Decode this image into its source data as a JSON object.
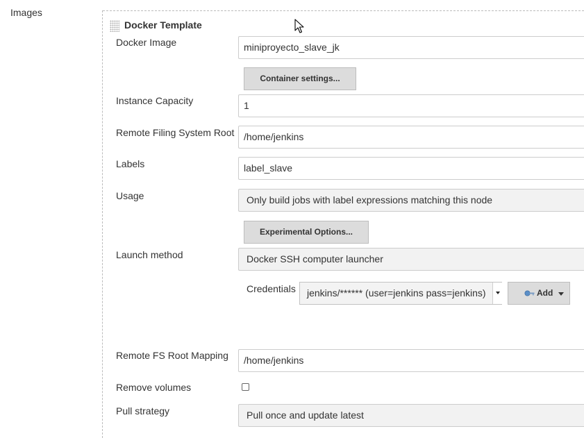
{
  "section": {
    "label": "Images"
  },
  "template": {
    "title": "Docker Template"
  },
  "fields": {
    "docker_image": {
      "label": "Docker Image",
      "value": "miniproyecto_slave_jk"
    },
    "container_settings_button": "Container settings...",
    "instance_capacity": {
      "label": "Instance Capacity",
      "value": "1"
    },
    "remote_fs_root": {
      "label": "Remote Filing System Root",
      "value": "/home/jenkins"
    },
    "labels": {
      "label": "Labels",
      "value": "label_slave"
    },
    "usage": {
      "label": "Usage",
      "value": "Only build jobs with label expressions matching this node"
    },
    "experimental_options_button": "Experimental Options...",
    "launch_method": {
      "label": "Launch method",
      "value": "Docker SSH computer launcher"
    },
    "credentials": {
      "label": "Credentials",
      "value": "jenkins/****** (user=jenkins pass=jenkins)",
      "add_label": "Add"
    },
    "remote_fs_root_mapping": {
      "label": "Remote FS Root Mapping",
      "value": "/home/jenkins"
    },
    "remove_volumes": {
      "label": "Remove volumes",
      "checked": false
    },
    "pull_strategy": {
      "label": "Pull strategy",
      "value": "Pull once and update latest"
    }
  }
}
